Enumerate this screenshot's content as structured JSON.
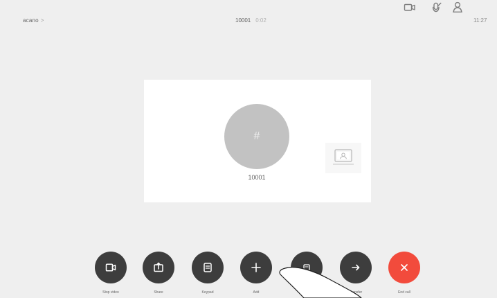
{
  "topbar": {
    "brand": "acano",
    "call_title": "10001",
    "call_duration": "0:02",
    "clock": "11:27",
    "icons": {
      "camera": "camera-icon",
      "mic": "microphone-mute-icon",
      "user": "person-icon"
    }
  },
  "card": {
    "avatar_symbol": "#",
    "label": "10001"
  },
  "controls": [
    {
      "label": "Stop video",
      "icon": "video-icon"
    },
    {
      "label": "Share",
      "icon": "share-icon"
    },
    {
      "label": "Keypad",
      "icon": "keypad-icon"
    },
    {
      "label": "Add",
      "icon": "plus-icon"
    },
    {
      "label": "",
      "icon": "participants-icon"
    },
    {
      "label": "Transfer",
      "icon": "arrow-right-icon"
    },
    {
      "label": "End call",
      "icon": "close-icon"
    }
  ],
  "colors": {
    "background": "#efefef",
    "card": "#ffffff",
    "button": "#3d3d3d",
    "end_call": "#f24b3c",
    "avatar": "#c2c2c2"
  }
}
